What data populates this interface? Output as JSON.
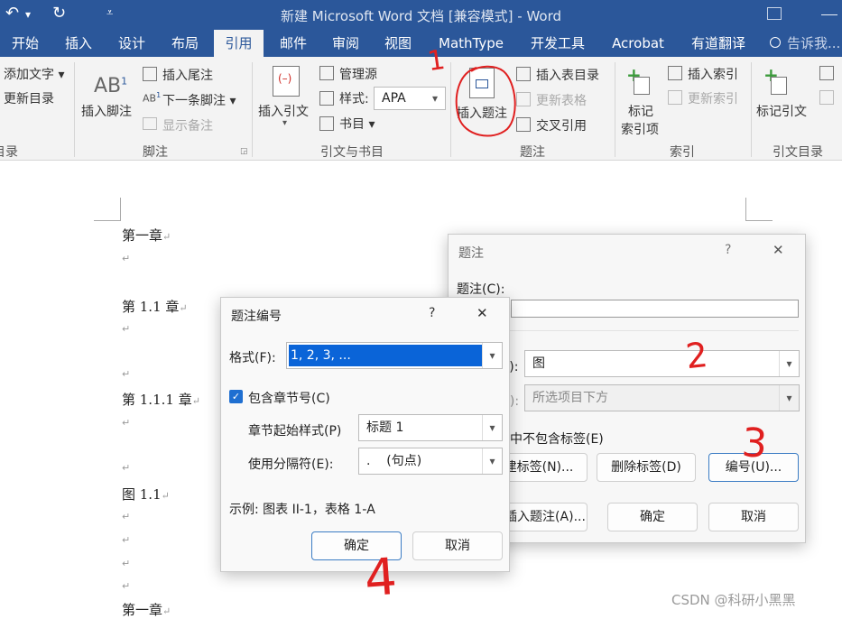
{
  "titlebar": {
    "title": "新建 Microsoft Word 文档 [兼容模式] - Word",
    "undo_glyph": "↶",
    "redo_glyph": "↻",
    "dropdown_glyph": "▾",
    "qa_more_glyph": "⩡"
  },
  "tabs": [
    "开始",
    "插入",
    "设计",
    "布局",
    "引用",
    "邮件",
    "审阅",
    "视图",
    "MathType",
    "开发工具",
    "Acrobat",
    "有道翻译",
    "告诉我..."
  ],
  "ribbon": {
    "toc": {
      "add_text": "添加文字 ▾",
      "update_toc": "更新目录",
      "group": "目录"
    },
    "footnotes": {
      "insert_footnote": "插入脚注",
      "insert_endnote": "插入尾注",
      "next_footnote": "下一条脚注 ▾",
      "show_notes": "显示备注",
      "group": "脚注",
      "ab_big": "AB",
      "ab_sup": "1",
      "ab_small": "AB",
      "ab_small_sup": "1"
    },
    "citations": {
      "insert_citation": "插入引文",
      "insert_citation_arrow": "▾",
      "manage_sources": "管理源",
      "style_label": "样式:",
      "style_value": "APA",
      "bibliography": "书目 ▾",
      "group": "引文与书目"
    },
    "captions": {
      "insert_caption": "插入题注",
      "insert_table_of_figures": "插入表目录",
      "update_table": "更新表格",
      "cross_reference": "交叉引用",
      "group": "题注"
    },
    "index": {
      "mark_entry_1": "标记",
      "mark_entry_2": "索引项",
      "insert_index": "插入索引",
      "update_index": "更新索引",
      "group": "索引"
    },
    "toa": {
      "mark_citation": "标记引文",
      "group": "引文目录"
    }
  },
  "document": {
    "lines": [
      "第一章",
      "",
      "第 1.1 章",
      "",
      "",
      "第 1.1.1 章",
      "",
      "",
      "图 1.1",
      "",
      "",
      "",
      "",
      "第一章"
    ],
    "para_mark": "↵"
  },
  "caption_dialog": {
    "title": "题注",
    "help": "?",
    "close": "✕",
    "caption_label": "题注(C):",
    "caption_value": "",
    "label_label": "签(L):",
    "label_value": "图",
    "position_label": "置(P):",
    "position_value": "所选项目下方",
    "exclude_label": "题注中不包含标签(E)",
    "new_label_btn": "新建标签(N)...",
    "delete_label_btn": "删除标签(D)",
    "numbering_btn": "编号(U)...",
    "autocaption_btn": "自动插入题注(A)...",
    "ok_btn": "确定",
    "cancel_btn": "取消"
  },
  "numbering_dialog": {
    "title": "题注编号",
    "help": "?",
    "close": "✕",
    "format_label": "格式(F):",
    "format_value": "1, 2, 3, ...",
    "include_chapter": "包含章节号(C)",
    "chapter_checkmark": "✓",
    "chapter_style_label": "章节起始样式(P)",
    "chapter_style_value": "标题 1",
    "separator_label": "使用分隔符(E):",
    "separator_value": ".    (句点)",
    "example": "示例:  图表 II-1，表格 1-A",
    "ok_btn": "确定",
    "cancel_btn": "取消"
  },
  "annotations": [
    "1",
    "2",
    "3",
    "4"
  ],
  "watermark": "CSDN @科研小黑黑"
}
